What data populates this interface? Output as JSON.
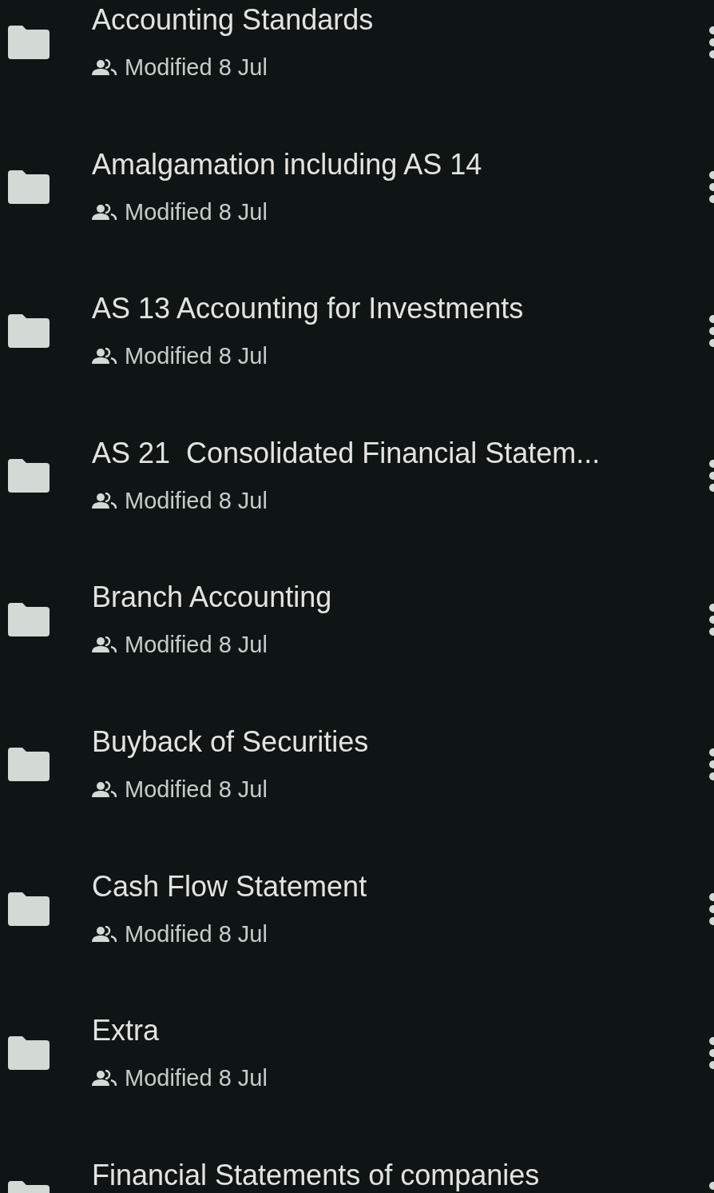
{
  "files": [
    {
      "name": "Accounting Standards",
      "subtitle": "Modified 8 Jul",
      "shared": true
    },
    {
      "name": "Amalgamation including AS 14",
      "subtitle": "Modified 8 Jul",
      "shared": true
    },
    {
      "name": "AS 13 Accounting for Investments",
      "subtitle": "Modified 8 Jul",
      "shared": true
    },
    {
      "name": "AS 21  Consolidated Financial Statem...",
      "subtitle": "Modified 8 Jul",
      "shared": true
    },
    {
      "name": "Branch Accounting",
      "subtitle": "Modified 8 Jul",
      "shared": true
    },
    {
      "name": "Buyback of Securities",
      "subtitle": "Modified 8 Jul",
      "shared": true
    },
    {
      "name": "Cash Flow Statement",
      "subtitle": "Modified 8 Jul",
      "shared": true
    },
    {
      "name": "Extra",
      "subtitle": "Modified 8 Jul",
      "shared": true
    },
    {
      "name": "Financial Statements of companies"
    }
  ]
}
